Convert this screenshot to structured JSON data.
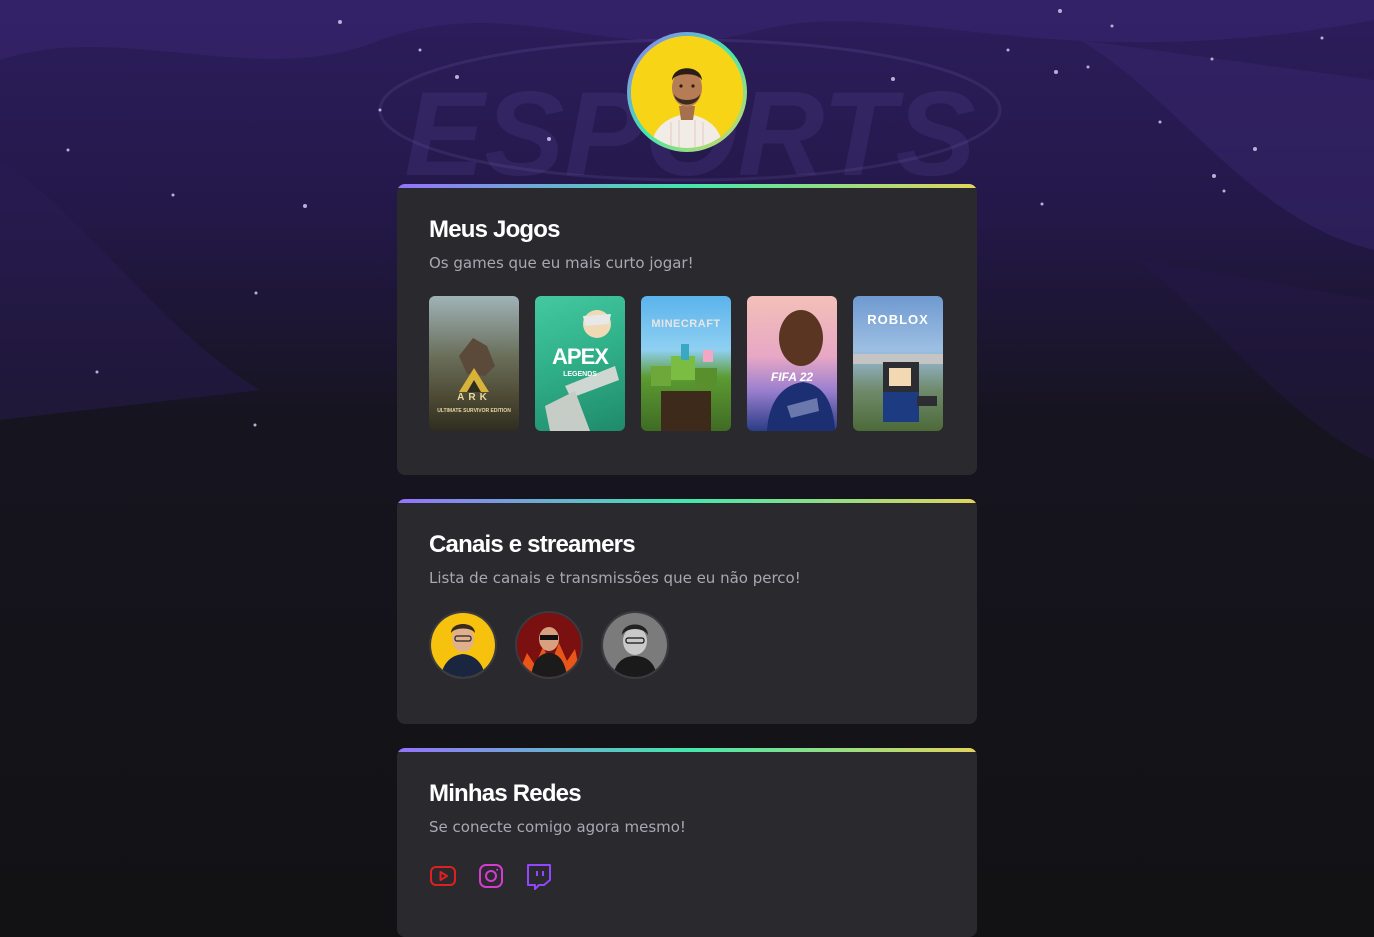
{
  "profile": {
    "avatar_alt": "Profile photo"
  },
  "games_card": {
    "title": "Meus Jogos",
    "subtitle": "Os games que eu mais curto jogar!",
    "games": [
      {
        "name": "ARK",
        "edition": "ULTIMATE SURVIVOR EDITION"
      },
      {
        "name": "APEX",
        "edition": "LEGENDS"
      },
      {
        "name": "MINECRAFT"
      },
      {
        "name": "FIFA 22"
      },
      {
        "name": "ROBLOX"
      }
    ]
  },
  "streamers_card": {
    "title": "Canais e streamers",
    "subtitle": "Lista de canais e transmissões que eu não perco!"
  },
  "socials_card": {
    "title": "Minhas Redes",
    "subtitle": "Se conecte comigo agora mesmo!",
    "links": [
      {
        "icon": "youtube-icon",
        "color": "#e02020"
      },
      {
        "icon": "instagram-icon",
        "color": "#d63bd1"
      },
      {
        "icon": "twitch-icon",
        "color": "#9147ff"
      }
    ]
  },
  "colors": {
    "background": "#121214",
    "card": "#29292e",
    "gradient": [
      "#9572fc",
      "#43e7ad",
      "#e2d45c"
    ],
    "text": "#ffffff",
    "muted": "#a8a8b3"
  }
}
